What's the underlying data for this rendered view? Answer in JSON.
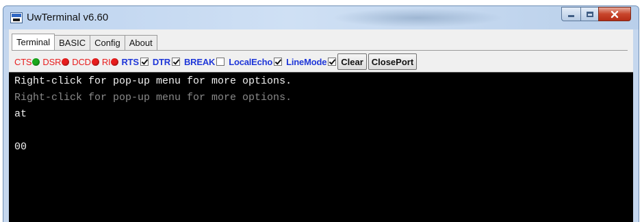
{
  "window": {
    "title": "UwTerminal v6.60"
  },
  "tabs": [
    {
      "label": "Terminal",
      "active": true
    },
    {
      "label": "BASIC",
      "active": false
    },
    {
      "label": "Config",
      "active": false
    },
    {
      "label": "About",
      "active": false
    }
  ],
  "signals": [
    {
      "label": "CTS",
      "led_color": "#18a81c"
    },
    {
      "label": "DSR",
      "led_color": "#e81d1d"
    },
    {
      "label": "DCD",
      "led_color": "#e81d1d"
    },
    {
      "label": "RI",
      "led_color": "#e81d1d"
    }
  ],
  "options": [
    {
      "label": "RTS",
      "checked": true
    },
    {
      "label": "DTR",
      "checked": true
    },
    {
      "label": "BREAK",
      "checked": false
    },
    {
      "label": "LocalEcho",
      "checked": true
    },
    {
      "label": "LineMode",
      "checked": true
    }
  ],
  "buttons": {
    "clear": "Clear",
    "close_port": "ClosePort"
  },
  "terminal": {
    "lines": [
      {
        "text": "Right-click for pop-up menu for more options.",
        "color": "#f2f2f2"
      },
      {
        "text": "Right-click for pop-up menu for more options.",
        "color": "#8a8a8a"
      },
      {
        "text": "at",
        "color": "#f2f2f2"
      },
      {
        "text": "",
        "color": "#f2f2f2"
      },
      {
        "text": "00",
        "color": "#f2f2f2"
      }
    ]
  },
  "colors": {
    "signal_label": "#e81d1d",
    "option_label": "#1f37d8",
    "terminal_bg": "#000000"
  }
}
